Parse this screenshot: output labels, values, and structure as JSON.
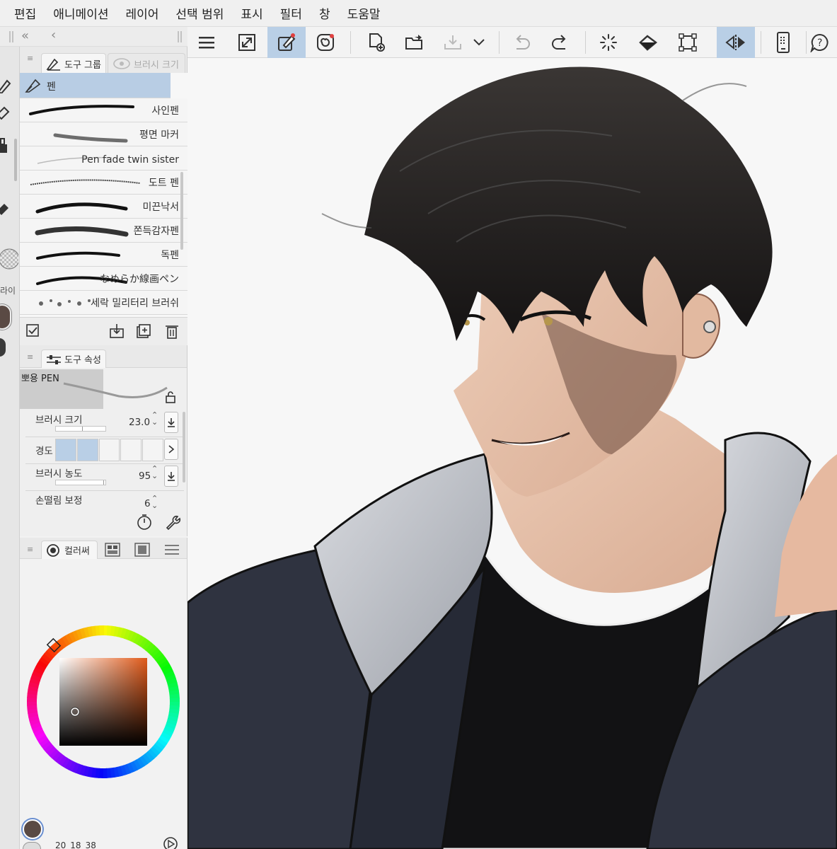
{
  "menubar": {
    "items": [
      "편집",
      "애니메이션",
      "레이어",
      "선택 범위",
      "표시",
      "필터",
      "창",
      "도움말"
    ]
  },
  "toolbar": {
    "icons": [
      "menu-icon",
      "fullscreen-icon",
      "pen-tool-icon",
      "spiral-icon",
      "new-file-icon",
      "open-folder-icon",
      "save-icon",
      "chevron-down-icon",
      "undo-icon",
      "redo-icon",
      "loading-icon",
      "fill-icon",
      "transform-icon",
      "flip-horizontal-icon",
      "smartphone-icon",
      "help-icon"
    ]
  },
  "tool_group_panel": {
    "tab_active": "도구 그룹",
    "tab_inactive": "브러시 크기",
    "group_label": "펜",
    "brushes": [
      {
        "name": "사인펜"
      },
      {
        "name": "평면 마커"
      },
      {
        "name": "Pen fade twin sister"
      },
      {
        "name": "도트 펜"
      },
      {
        "name": "미끈낙서"
      },
      {
        "name": "쫀득감자펜"
      },
      {
        "name": "독펜"
      },
      {
        "name": "なめらか線画ペン"
      },
      {
        "name": "세락 밀리터리 브러쉬"
      }
    ]
  },
  "tool_property_panel": {
    "tab_label": "도구 속성",
    "brush_name": "뽀용 PEN",
    "brush_size_label": "브러시 크기",
    "brush_size_value": "23.0",
    "hardness_label": "경도",
    "hardness_level": 2,
    "hardness_steps": 5,
    "density_label": "브러시 농도",
    "density_value": "95",
    "stabilizer_label": "손떨림 보정",
    "stabilizer_value": "6"
  },
  "color_panel": {
    "tab_label": "컬러써",
    "current_color": "#5a4a44",
    "hue_color": "#e05a1a",
    "readout_1": "20",
    "readout_2": "18",
    "readout_3": "38"
  },
  "left_strip": {
    "label": "라이"
  },
  "colors": {
    "accent": "#b9cfe6",
    "panel": "#f2f2f2",
    "hair": "#1f1d1d",
    "jacket": "#2f3340",
    "collar": "#c3c6cc",
    "skin": "#e8c4ad"
  }
}
